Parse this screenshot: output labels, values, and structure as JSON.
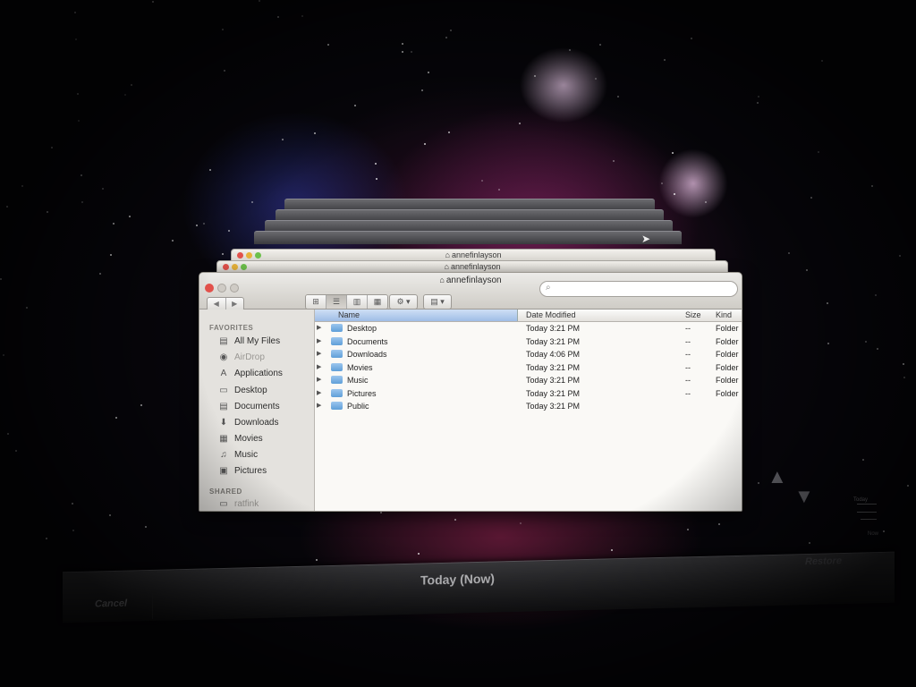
{
  "window": {
    "title": "annefinlayson",
    "stacked_titles": [
      "annefinlayson",
      "annefinlayson"
    ]
  },
  "toolbar": {
    "nav_back": "◀",
    "nav_forward": "▶",
    "view_icons": "⊞",
    "view_list": "☰",
    "view_columns": "▥",
    "view_coverflow": "▦",
    "action": "⚙ ▾",
    "arrange": "▤ ▾",
    "search_placeholder": ""
  },
  "sidebar": {
    "favorites_heading": "FAVORITES",
    "items": [
      {
        "label": "All My Files",
        "icon": "all-files-icon",
        "glyph": "▤"
      },
      {
        "label": "AirDrop",
        "icon": "airdrop-icon",
        "glyph": "◉"
      },
      {
        "label": "Applications",
        "icon": "applications-icon",
        "glyph": "A"
      },
      {
        "label": "Desktop",
        "icon": "desktop-icon",
        "glyph": "▭"
      },
      {
        "label": "Documents",
        "icon": "documents-icon",
        "glyph": "▤"
      },
      {
        "label": "Downloads",
        "icon": "downloads-icon",
        "glyph": "⬇"
      },
      {
        "label": "Movies",
        "icon": "movies-icon",
        "glyph": "▦"
      },
      {
        "label": "Music",
        "icon": "music-icon",
        "glyph": "♫"
      },
      {
        "label": "Pictures",
        "icon": "pictures-icon",
        "glyph": "▣"
      }
    ],
    "shared_heading": "SHARED",
    "shared_items": [
      {
        "label": "ratfink",
        "icon": "computer-icon",
        "glyph": "▭"
      }
    ]
  },
  "columns": {
    "name": "Name",
    "date": "Date Modified",
    "size": "Size",
    "kind": "Kind"
  },
  "rows": [
    {
      "name": "Desktop",
      "date": "Today 3:21 PM",
      "size": "--",
      "kind": "Folder"
    },
    {
      "name": "Documents",
      "date": "Today 3:21 PM",
      "size": "--",
      "kind": "Folder"
    },
    {
      "name": "Downloads",
      "date": "Today 4:06 PM",
      "size": "--",
      "kind": "Folder"
    },
    {
      "name": "Movies",
      "date": "Today 3:21 PM",
      "size": "--",
      "kind": "Folder"
    },
    {
      "name": "Music",
      "date": "Today 3:21 PM",
      "size": "--",
      "kind": "Folder"
    },
    {
      "name": "Pictures",
      "date": "Today 3:21 PM",
      "size": "--",
      "kind": "Folder"
    },
    {
      "name": "Public",
      "date": "Today 3:21 PM",
      "size": "",
      "kind": ""
    }
  ],
  "timeline": {
    "label_today": "Today",
    "label_now": "Now"
  },
  "bottom_bar": {
    "cancel": "Cancel",
    "current": "Today (Now)",
    "restore": "Restore"
  }
}
